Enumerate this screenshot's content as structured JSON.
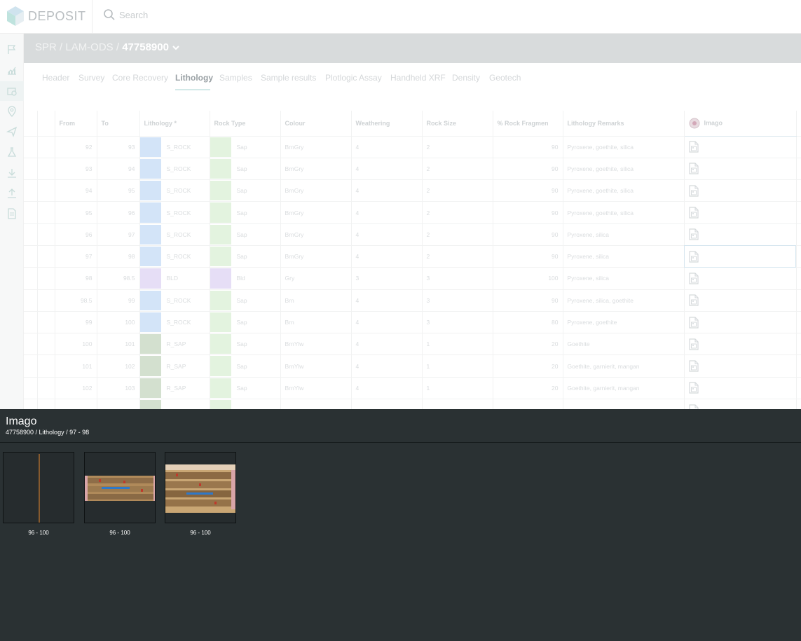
{
  "app": {
    "logo_text": "DEPOSIT"
  },
  "search": {
    "placeholder": "Search"
  },
  "sidebar": {
    "items": [
      {
        "icon": "flag-icon"
      },
      {
        "icon": "chart-icon"
      },
      {
        "icon": "core-images-icon",
        "active": true
      },
      {
        "icon": "map-pin-icon"
      },
      {
        "icon": "send-icon"
      },
      {
        "icon": "flask-icon"
      },
      {
        "icon": "download-icon"
      },
      {
        "icon": "upload-icon"
      },
      {
        "icon": "document-icon"
      }
    ]
  },
  "breadcrumb": {
    "path": "SPR / LAM-ODS / ",
    "hole": "47758900"
  },
  "tabs": [
    {
      "label": "Header"
    },
    {
      "label": "Survey"
    },
    {
      "label": "Core Recovery"
    },
    {
      "label": "Lithology",
      "active": true
    },
    {
      "label": "Samples"
    },
    {
      "label": "Sample results"
    },
    {
      "label": "Plotlogic Assay"
    },
    {
      "label": "Handheld XRF"
    },
    {
      "label": "Density"
    },
    {
      "label": "Geotech"
    }
  ],
  "table": {
    "columns": {
      "from": "From",
      "to": "To",
      "lithology": "Lithology *",
      "rock_type": "Rock Type",
      "colour": "Colour",
      "weathering": "Weathering",
      "rock_size": "Rock Size",
      "rock_frag": "% Rock Fragmen",
      "remarks": "Lithology Remarks",
      "imago": "Imago"
    },
    "rows": [
      {
        "from": "92",
        "to": "93",
        "lith": "S_ROCK",
        "lith_color": "#d3e4f8",
        "rock": "Sap",
        "rock_color": "#e3f3df",
        "colour": "BrnGry",
        "weath": "4",
        "size": "2",
        "frag": "90",
        "remarks": "Pyroxene, goethite, silica"
      },
      {
        "from": "93",
        "to": "94",
        "lith": "S_ROCK",
        "lith_color": "#d3e4f8",
        "rock": "Sap",
        "rock_color": "#e3f3df",
        "colour": "BrnGry",
        "weath": "4",
        "size": "2",
        "frag": "90",
        "remarks": "Pyroxene, goethite, silica"
      },
      {
        "from": "94",
        "to": "95",
        "lith": "S_ROCK",
        "lith_color": "#d3e4f8",
        "rock": "Sap",
        "rock_color": "#e3f3df",
        "colour": "BrnGry",
        "weath": "4",
        "size": "2",
        "frag": "90",
        "remarks": "Pyroxene, goethite, silica"
      },
      {
        "from": "95",
        "to": "96",
        "lith": "S_ROCK",
        "lith_color": "#d3e4f8",
        "rock": "Sap",
        "rock_color": "#e3f3df",
        "colour": "BrnGry",
        "weath": "4",
        "size": "2",
        "frag": "90",
        "remarks": "Pyroxene, goethite, silica"
      },
      {
        "from": "96",
        "to": "97",
        "lith": "S_ROCK",
        "lith_color": "#d3e4f8",
        "rock": "Sap",
        "rock_color": "#e3f3df",
        "colour": "BrnGry",
        "weath": "4",
        "size": "2",
        "frag": "90",
        "remarks": "Pyroxene, silica"
      },
      {
        "from": "97",
        "to": "98",
        "lith": "S_ROCK",
        "lith_color": "#d3e4f8",
        "rock": "Sap",
        "rock_color": "#e3f3df",
        "colour": "BrnGry",
        "weath": "4",
        "size": "2",
        "frag": "90",
        "remarks": "Pyroxene, silica",
        "selected": true
      },
      {
        "from": "98",
        "to": "98.5",
        "lith": "BLD",
        "lith_color": "#e6def6",
        "rock": "Bld",
        "rock_color": "#e6def6",
        "colour": "Gry",
        "weath": "3",
        "size": "3",
        "frag": "100",
        "remarks": "Pyroxene, silica"
      },
      {
        "from": "98.5",
        "to": "99",
        "lith": "S_ROCK",
        "lith_color": "#d3e4f8",
        "rock": "Sap",
        "rock_color": "#e3f3df",
        "colour": "Brn",
        "weath": "4",
        "size": "3",
        "frag": "90",
        "remarks": "Pyroxene, silica, goethite"
      },
      {
        "from": "99",
        "to": "100",
        "lith": "S_ROCK",
        "lith_color": "#d3e4f8",
        "rock": "Sap",
        "rock_color": "#e3f3df",
        "colour": "Brn",
        "weath": "4",
        "size": "3",
        "frag": "80",
        "remarks": "Pyroxene, goethite"
      },
      {
        "from": "100",
        "to": "101",
        "lith": "R_SAP",
        "lith_color": "#d3e0cf",
        "rock": "Sap",
        "rock_color": "#e3f3df",
        "colour": "BrnYlw",
        "weath": "4",
        "size": "1",
        "frag": "20",
        "remarks": "Goethite"
      },
      {
        "from": "101",
        "to": "102",
        "lith": "R_SAP",
        "lith_color": "#d3e0cf",
        "rock": "Sap",
        "rock_color": "#e3f3df",
        "colour": "BrnYlw",
        "weath": "4",
        "size": "1",
        "frag": "20",
        "remarks": "Goethite, garnierit, mangan"
      },
      {
        "from": "102",
        "to": "103",
        "lith": "R_SAP",
        "lith_color": "#d3e0cf",
        "rock": "Sap",
        "rock_color": "#e3f3df",
        "colour": "BrnYlw",
        "weath": "4",
        "size": "1",
        "frag": "20",
        "remarks": "Goethite, garnierit, mangan"
      },
      {
        "from": "",
        "to": "",
        "lith": "",
        "lith_color": "#d3e0cf",
        "rock": "",
        "rock_color": "#e3f3df",
        "colour": "",
        "weath": "",
        "size": "",
        "frag": "",
        "remarks": ""
      }
    ]
  },
  "imago_panel": {
    "title": "Imago",
    "subtitle": "47758900 / Lithology / 97 - 98",
    "thumbnails": [
      {
        "caption": "96 - 100",
        "kind": "line"
      },
      {
        "caption": "96 - 100",
        "kind": "tray"
      },
      {
        "caption": "96 - 100",
        "kind": "tray-box"
      }
    ]
  }
}
